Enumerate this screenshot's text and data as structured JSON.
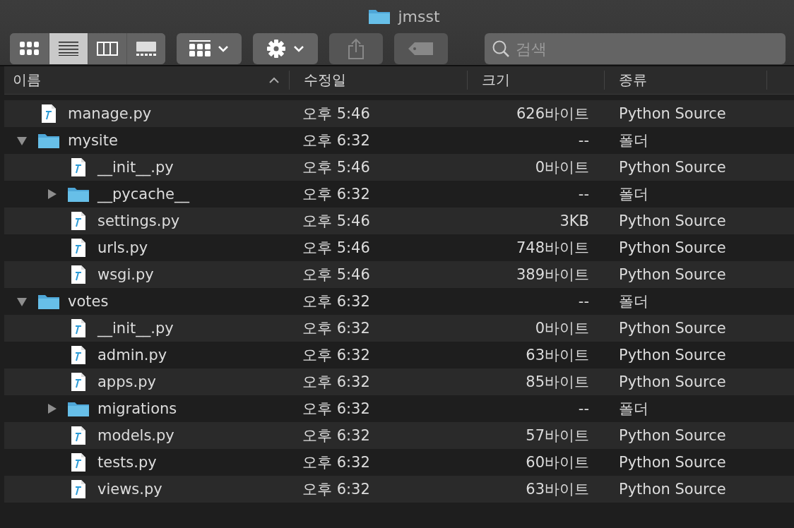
{
  "window": {
    "title": "jmsst"
  },
  "view_modes": [
    {
      "selected": false
    },
    {
      "selected": true
    },
    {
      "selected": false
    },
    {
      "selected": false
    }
  ],
  "search": {
    "placeholder": "검색"
  },
  "columns": [
    {
      "label": "이름",
      "sorted": true
    },
    {
      "label": "수정일",
      "sorted": false
    },
    {
      "label": "크기",
      "sorted": false
    },
    {
      "label": "종류",
      "sorted": false
    }
  ],
  "rows": [
    {
      "kind": "file",
      "name": "manage.py",
      "modified": "오후 5:46",
      "size": "626바이트",
      "type": "Python Source"
    },
    {
      "kind": "folder",
      "expanded": true,
      "name": "mysite",
      "modified": "오후 6:32",
      "size": "--",
      "type": "폴더",
      "children": [
        {
          "kind": "file",
          "name": "__init__.py",
          "modified": "오후 5:46",
          "size": "0바이트",
          "type": "Python Source"
        },
        {
          "kind": "folder",
          "expanded": false,
          "name": "__pycache__",
          "modified": "오후 6:32",
          "size": "--",
          "type": "폴더"
        },
        {
          "kind": "file",
          "name": "settings.py",
          "modified": "오후 5:46",
          "size": "3KB",
          "type": "Python Source"
        },
        {
          "kind": "file",
          "name": "urls.py",
          "modified": "오후 5:46",
          "size": "748바이트",
          "type": "Python Source"
        },
        {
          "kind": "file",
          "name": "wsgi.py",
          "modified": "오후 5:46",
          "size": "389바이트",
          "type": "Python Source"
        }
      ]
    },
    {
      "kind": "folder",
      "expanded": true,
      "name": "votes",
      "modified": "오후 6:32",
      "size": "--",
      "type": "폴더",
      "children": [
        {
          "kind": "file",
          "name": "__init__.py",
          "modified": "오후 6:32",
          "size": "0바이트",
          "type": "Python Source"
        },
        {
          "kind": "file",
          "name": "admin.py",
          "modified": "오후 6:32",
          "size": "63바이트",
          "type": "Python Source"
        },
        {
          "kind": "file",
          "name": "apps.py",
          "modified": "오후 6:32",
          "size": "85바이트",
          "type": "Python Source"
        },
        {
          "kind": "folder",
          "expanded": false,
          "name": "migrations",
          "modified": "오후 6:32",
          "size": "--",
          "type": "폴더"
        },
        {
          "kind": "file",
          "name": "models.py",
          "modified": "오후 6:32",
          "size": "57바이트",
          "type": "Python Source"
        },
        {
          "kind": "file",
          "name": "tests.py",
          "modified": "오후 6:32",
          "size": "60바이트",
          "type": "Python Source"
        },
        {
          "kind": "file",
          "name": "views.py",
          "modified": "오후 6:32",
          "size": "63바이트",
          "type": "Python Source"
        }
      ]
    }
  ]
}
